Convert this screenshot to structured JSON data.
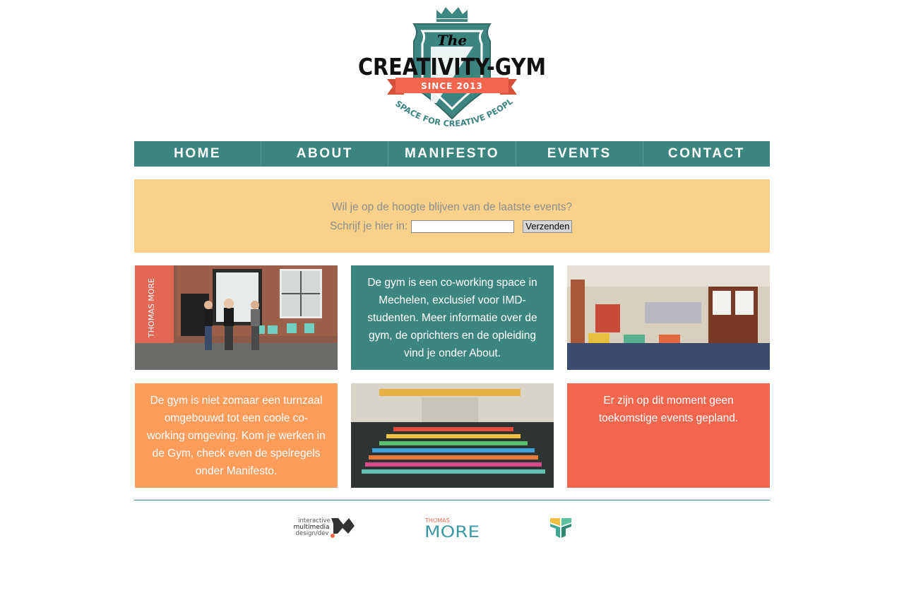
{
  "logo": {
    "title_small": "The",
    "title_main": "CREATIVITY-GYM",
    "since": "SINCE 2013",
    "tagline": "A SPACE FOR CREATIVE PEOPLE"
  },
  "nav": {
    "items": [
      {
        "label": "HOME"
      },
      {
        "label": "ABOUT"
      },
      {
        "label": "MANIFESTO"
      },
      {
        "label": "EVENTS"
      },
      {
        "label": "CONTACT"
      }
    ]
  },
  "newsletter": {
    "question": "Wil je op de hoogte blijven van de laatste events?",
    "label": "Schrijf je hier in:",
    "input_value": "",
    "button_label": "Verzenden"
  },
  "tiles": {
    "about_text": "De gym is een co-working space in Mechelen, exclusief voor IMD-studenten. Meer informatie over de gym, de oprichters en de opleiding vind je onder About.",
    "manifesto_text": "De gym is niet zomaar een turnzaal omgebouwd tot een coole co-working omgeving. Kom je werken in de Gym, check even de spelregels onder Manifesto.",
    "events_text": "Er zijn op dit moment geen toekomstige events gepland.",
    "photo1_sign": "THOMAS MORE"
  },
  "footer": {
    "imd_line1": "interactive",
    "imd_line2": "multimedia",
    "imd_line3": "design/dev",
    "tm_small": "THOMAS",
    "tm_big": "MORE"
  },
  "colors": {
    "teal": "#3d8580",
    "coral": "#f26650",
    "orange": "#fd9c5b",
    "yellow": "#fad18a"
  }
}
